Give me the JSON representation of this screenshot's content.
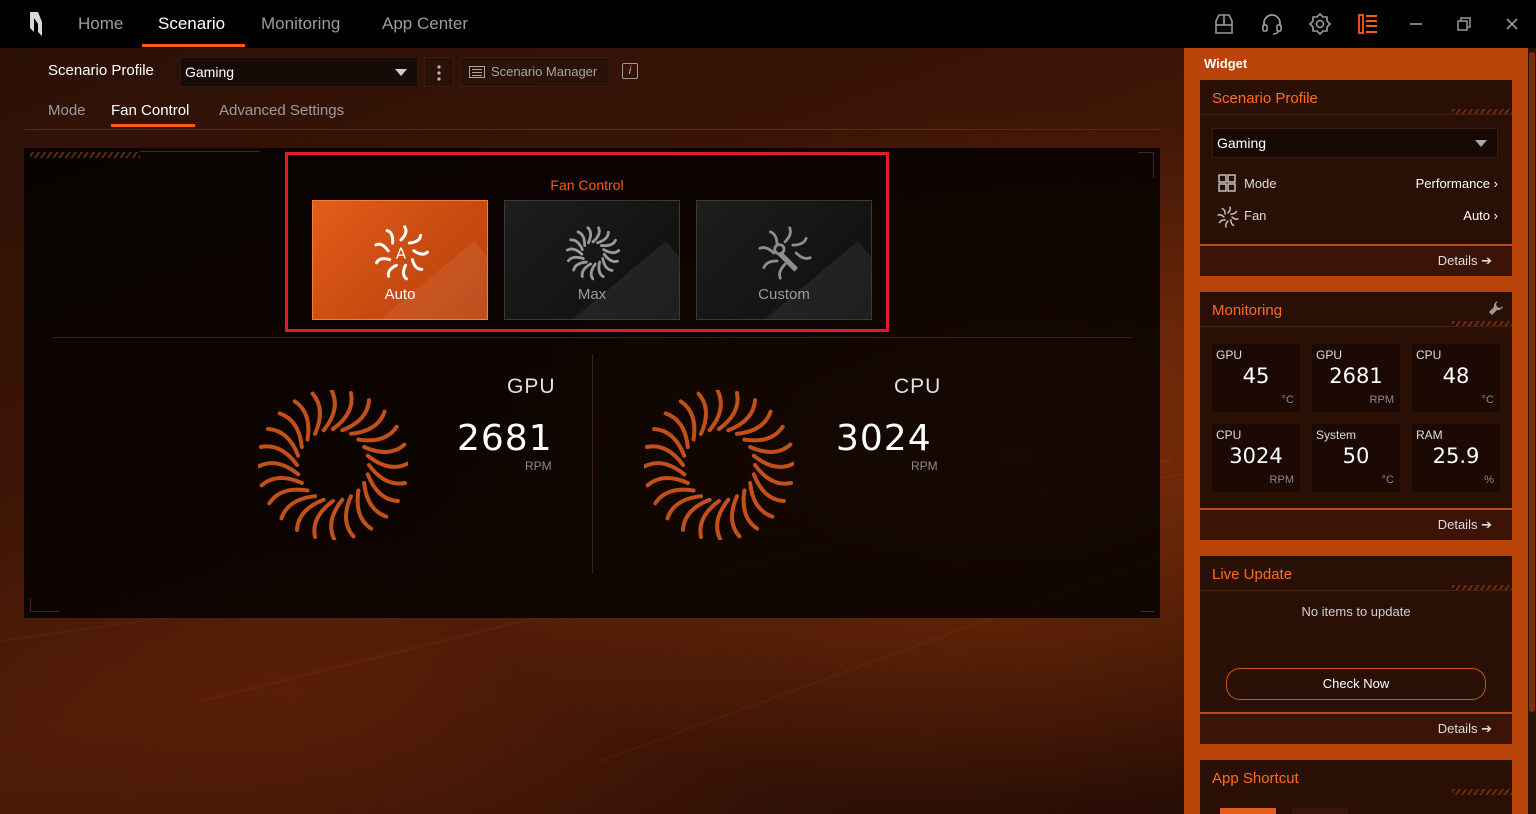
{
  "nav": {
    "tabs": [
      "Home",
      "Scenario",
      "Monitoring",
      "App Center"
    ],
    "active_index": 1
  },
  "topbar": {
    "icons": [
      "widget-icon",
      "headset-icon",
      "settings-icon",
      "list-icon"
    ],
    "window_controls": [
      "minimize-icon",
      "restore-icon",
      "close-icon"
    ]
  },
  "profile": {
    "label": "Scenario Profile",
    "selected": "Gaming",
    "manager_label": "Scenario Manager",
    "info_glyph": "i"
  },
  "subtabs": {
    "items": [
      "Mode",
      "Fan Control",
      "Advanced Settings"
    ],
    "active_index": 1
  },
  "fan_control": {
    "title": "Fan Control",
    "modes": [
      {
        "label": "Auto",
        "icon": "fan-auto-icon",
        "selected": true
      },
      {
        "label": "Max",
        "icon": "fan-max-icon",
        "selected": false
      },
      {
        "label": "Custom",
        "icon": "fan-custom-icon",
        "selected": false
      }
    ],
    "fans": [
      {
        "name": "GPU",
        "rpm": "2681",
        "unit": "RPM"
      },
      {
        "name": "CPU",
        "rpm": "3024",
        "unit": "RPM"
      }
    ]
  },
  "widget": {
    "title": "Widget",
    "scenario_card": {
      "title": "Scenario Profile",
      "selected": "Gaming",
      "mode_label": "Mode",
      "mode_value": "Performance",
      "fan_label": "Fan",
      "fan_value": "Auto",
      "details": "Details"
    },
    "monitoring_card": {
      "title": "Monitoring",
      "tiles": [
        {
          "label": "GPU",
          "value": "45",
          "unit": "°C"
        },
        {
          "label": "GPU",
          "value": "2681",
          "unit": "RPM"
        },
        {
          "label": "CPU",
          "value": "48",
          "unit": "°C"
        },
        {
          "label": "CPU",
          "value": "3024",
          "unit": "RPM"
        },
        {
          "label": "System",
          "value": "50",
          "unit": "°C"
        },
        {
          "label": "RAM",
          "value": "25.9",
          "unit": "%"
        }
      ],
      "details": "Details"
    },
    "live_update_card": {
      "title": "Live Update",
      "message": "No items to update",
      "button": "Check Now",
      "details": "Details"
    },
    "app_shortcut_card": {
      "title": "App Shortcut"
    }
  },
  "colors": {
    "accent": "#ff5a12",
    "highlight_box": "#e21b2a",
    "widget_bg": "#b8440a"
  }
}
